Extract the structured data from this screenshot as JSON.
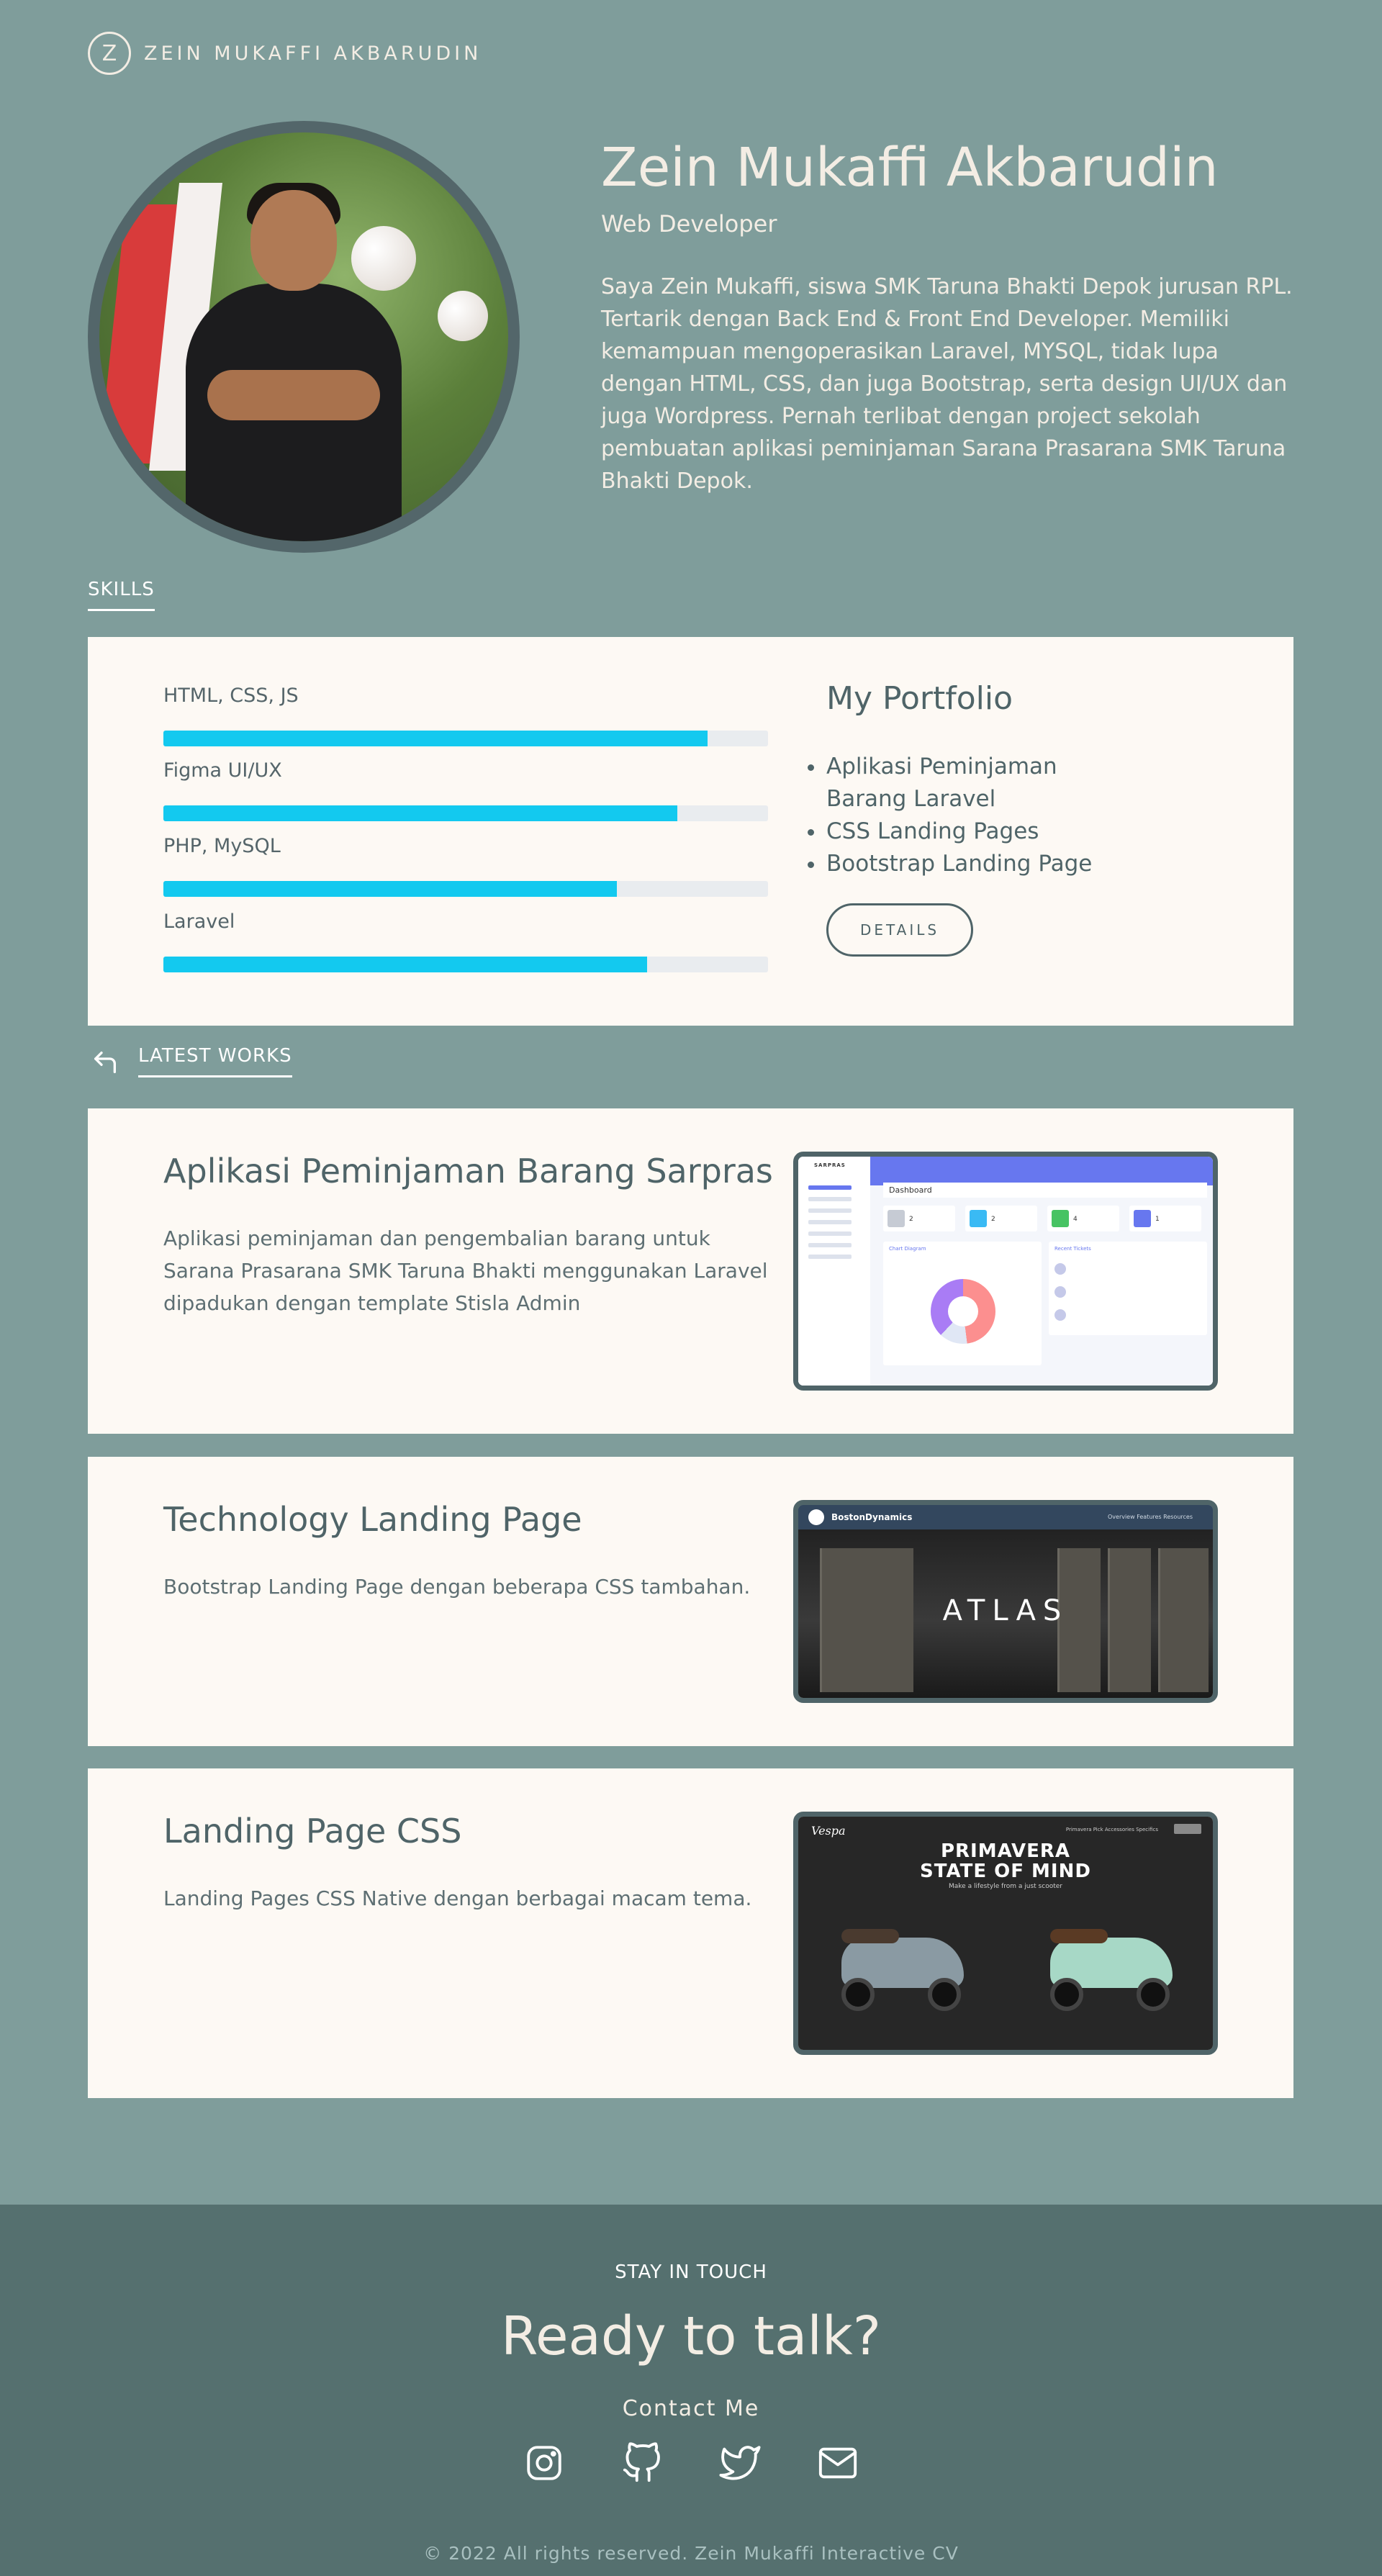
{
  "header": {
    "logo_letter": "Z",
    "brand": "ZEIN MUKAFFI AKBARUDIN"
  },
  "hero": {
    "name": "Zein Mukaffi Akbarudin",
    "role": "Web Developer",
    "description": "Saya Zein Mukaffi, siswa SMK Taruna Bhakti Depok jurusan RPL. Tertarik dengan Back End & Front End Developer. Memiliki kemampuan mengoperasikan Laravel, MYSQL, tidak lupa dengan HTML, CSS, dan juga Bootstrap, serta design UI/UX dan juga Wordpress. Pernah terlibat dengan project sekolah pembuatan aplikasi peminjaman Sarana Prasarana SMK Taruna Bhakti Depok."
  },
  "skills": {
    "section_label": "SKILLS",
    "items": [
      {
        "label": "HTML, CSS, JS",
        "level": 90
      },
      {
        "label": "Figma UI/UX",
        "level": 85
      },
      {
        "label": "PHP, MySQL",
        "level": 75
      },
      {
        "label": "Laravel",
        "level": 80
      }
    ]
  },
  "portfolio": {
    "title": "My Portfolio",
    "items": [
      "Aplikasi Peminjaman Barang Laravel",
      "CSS Landing Pages",
      "Bootstrap Landing Page"
    ],
    "button": "DETAILS"
  },
  "works": {
    "section_label": "LATEST WORKS",
    "items": [
      {
        "title": "Aplikasi Peminjaman Barang Sarpras",
        "description": "Aplikasi peminjaman dan pengembalian barang untuk Sarana Prasarana SMK Taruna Bhakti menggunakan Laravel dipadukan dengan template Stisla Admin",
        "preview": {
          "sidebar_logo": "SARPRAS",
          "page_title": "Dashboard",
          "stat_values": [
            "2",
            "2",
            "4",
            "1"
          ],
          "panel_title": "Chart Diagram",
          "list_title": "Recent Tickets"
        }
      },
      {
        "title": "Technology Landing Page",
        "description": "Bootstrap Landing Page dengan beberapa CSS tambahan.",
        "preview": {
          "brand": "BostonDynamics",
          "nav": "Overview   Features   Resources",
          "hero_text": "ATLAS"
        }
      },
      {
        "title": "Landing Page CSS",
        "description": "Landing Pages CSS Native dengan berbagai macam tema.",
        "preview": {
          "logo": "Vespa",
          "nav": "Primavera    Pick Accessories    Specifics",
          "headline": "PRIMAVERA STATE OF MIND",
          "subline": "Make a lifestyle from a just scooter"
        }
      }
    ]
  },
  "footer": {
    "kicker": "STAY IN TOUCH",
    "heading": "Ready to talk?",
    "contact": "Contact Me",
    "social": [
      "instagram-icon",
      "github-icon",
      "twitter-icon",
      "mail-icon"
    ],
    "copyright": "© 2022 All rights reserved. Zein Mukaffi Interactive CV"
  },
  "colors": {
    "background": "#7f9d9b",
    "card": "#fdf9f4",
    "accent": "#13c9ef",
    "footer": "#55706f",
    "text_dark": "#4f6468"
  }
}
